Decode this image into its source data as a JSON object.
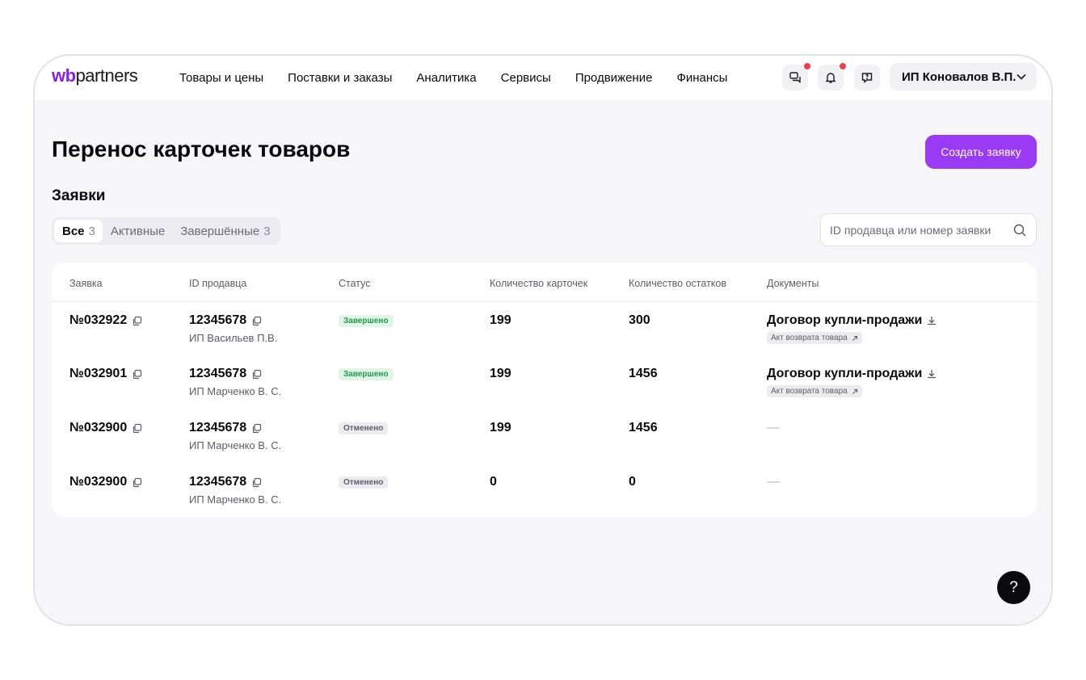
{
  "logo": {
    "wb": "wb",
    "partners": "partners"
  },
  "nav": [
    "Товары и цены",
    "Поставки и заказы",
    "Аналитика",
    "Сервисы",
    "Продвижение",
    "Финансы"
  ],
  "header_icons": [
    "chat-icon",
    "bell-icon",
    "feedback-icon"
  ],
  "account": {
    "name": "ИП Коновалов В.П."
  },
  "page": {
    "title": "Перенос карточек товаров",
    "create_button": "Создать заявку",
    "section_title": "Заявки"
  },
  "tabs": [
    {
      "label": "Все",
      "count": "3",
      "active": true
    },
    {
      "label": "Активные",
      "count": "",
      "active": false
    },
    {
      "label": "Завершённые",
      "count": "3",
      "active": false
    }
  ],
  "search": {
    "placeholder": "ID продавца или номер заявки",
    "value": ""
  },
  "table": {
    "columns": [
      "Заявка",
      "ID продавца",
      "Статус",
      "Количество карточек",
      "Количество остатков",
      "Документы"
    ],
    "rows": [
      {
        "request": "№032922",
        "seller_id": "12345678",
        "seller_name": "ИП Васильев П.В.",
        "status": "Завершено",
        "status_type": "done",
        "cards": "199",
        "stock": "300",
        "document": "Договор купли-продажи",
        "act": "Акт возврата товара"
      },
      {
        "request": "№032901",
        "seller_id": "12345678",
        "seller_name": "ИП Марченко В. С.",
        "status": "Завершено",
        "status_type": "done",
        "cards": "199",
        "stock": "1456",
        "document": "Договор купли-продажи",
        "act": "Акт возврата товара"
      },
      {
        "request": "№032900",
        "seller_id": "12345678",
        "seller_name": "ИП Марченко В. С.",
        "status": "Отменено",
        "status_type": "cancel",
        "cards": "199",
        "stock": "1456",
        "document": "—",
        "act": ""
      },
      {
        "request": "№032900",
        "seller_id": "12345678",
        "seller_name": "ИП Марченко В. С.",
        "status": "Отменено",
        "status_type": "cancel",
        "cards": "0",
        "stock": "0",
        "document": "—",
        "act": ""
      }
    ]
  },
  "help": {
    "label": "?"
  },
  "colors": {
    "accent": "#9b3af4",
    "brand": "#8a21e8",
    "notification": "#f23d4a",
    "success_bg": "#e0f5e7",
    "success_text": "#1f9a4a"
  }
}
